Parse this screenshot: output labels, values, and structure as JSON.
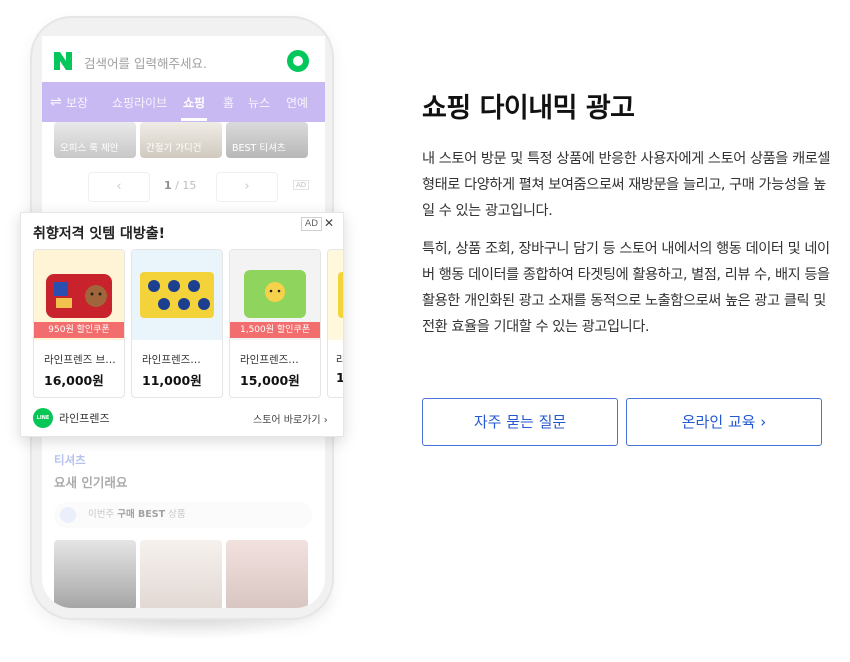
{
  "phone": {
    "search_placeholder": "검색어를 입력해주세요.",
    "nav_swap_icon": "⇌",
    "nav_tabs": [
      "보장",
      "쇼핑라이브",
      "쇼핑",
      "홈",
      "뉴스",
      "연예"
    ],
    "active_tab": "쇼핑",
    "thumb_labels": [
      "오피스 룩 제안",
      "간절기 가디건",
      "BEST 티셔츠"
    ],
    "pager": {
      "prev": "‹",
      "next": "›",
      "current": "1",
      "separator": " / ",
      "total": "15",
      "ad": "AD"
    },
    "bottom_section": {
      "title": "티셔츠",
      "subtitle": "요새 인기래요",
      "best_prefix": "이번주",
      "best_bold": "구매 BEST",
      "best_suffix": "상품"
    }
  },
  "ad_card": {
    "title": "취향저격 잇템 대방출!",
    "badge": "AD",
    "close": "✕",
    "products": [
      {
        "name": "라인프렌즈 브…",
        "price": "16,000원",
        "coupon": "950원 할인쿠폰"
      },
      {
        "name": "라인프렌즈…",
        "price": "11,000원",
        "coupon": ""
      },
      {
        "name": "라인프렌즈…",
        "price": "15,000원",
        "coupon": "1,500원 할인쿠폰"
      },
      {
        "name": "라",
        "price": "1",
        "coupon": ""
      }
    ],
    "store_logo": "LINE FRIENDS",
    "store_name": "라인프렌즈",
    "store_link": "스토어 바로가기 ›"
  },
  "content": {
    "heading": "쇼핑 다이내믹 광고",
    "para1": "내 스토어 방문 및 특정 상품에 반응한 사용자에게 스토어 상품을 캐로셀 형태로 다양하게 펼쳐 보여줌으로써 재방문을 늘리고, 구매 가능성을 높일 수 있는 광고입니다.",
    "para2": "특히, 상품 조회, 장바구니 담기 등 스토어 내에서의 행동 데이터 및 네이버 행동 데이터를 종합하여 타겟팅에 활용하고, 별점, 리뷰 수, 배지 등을 활용한 개인화된 광고 소재를 동적으로 노출함으로써 높은 광고 클릭 및 전환 효율을 기대할 수 있는 광고입니다.",
    "faq_button": "자주 묻는 질문",
    "edu_button": "온라인 교육 ›"
  },
  "colors": {
    "accent": "#2458d4",
    "naver_green": "#03c75a",
    "nav_bar": "#c8b9f2",
    "coupon": "#f26d6d"
  }
}
